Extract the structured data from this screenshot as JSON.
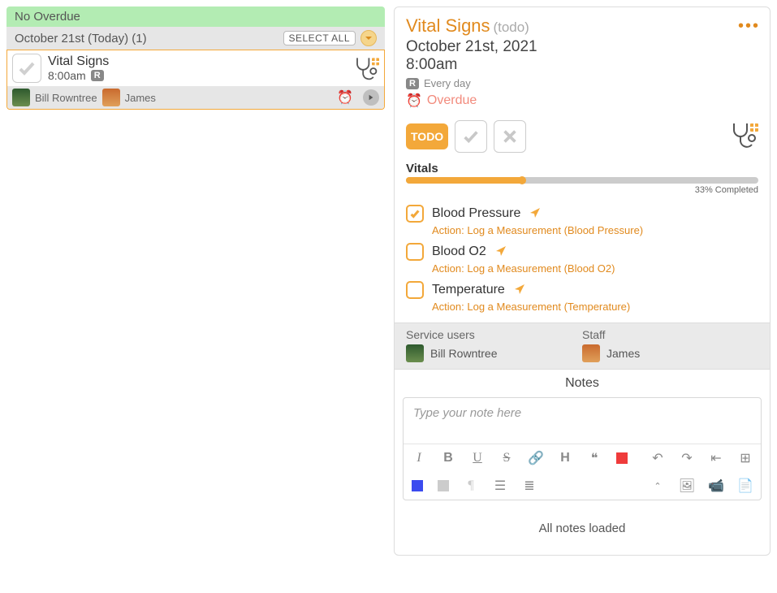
{
  "left": {
    "overdue": "No Overdue",
    "date_label": "October 21st (Today) (1)",
    "select_all": "SELECT ALL",
    "task": {
      "title": "Vital Signs",
      "time": "8:00am",
      "recur_badge": "R",
      "user1": "Bill Rowntree",
      "user2": "James"
    }
  },
  "detail": {
    "title": "Vital Signs",
    "status": "(todo)",
    "date": "October 21st, 2021",
    "time": "8:00am",
    "recur_badge": "R",
    "recur_text": "Every day",
    "overdue": "Overdue",
    "todo_btn": "TODO",
    "vitals_label": "Vitals",
    "progress_pct": 33,
    "progress_label": "33% Completed",
    "items": [
      {
        "name": "Blood Pressure",
        "action": "Action: Log a Measurement (Blood Pressure)",
        "checked": true
      },
      {
        "name": "Blood O2",
        "action": "Action: Log a Measurement (Blood O2)",
        "checked": false
      },
      {
        "name": "Temperature",
        "action": "Action: Log a Measurement (Temperature)",
        "checked": false
      }
    ],
    "people": {
      "su_head": "Service users",
      "su_name": "Bill Rowntree",
      "staff_head": "Staff",
      "staff_name": "James"
    },
    "notes_head": "Notes",
    "notes_placeholder": "Type your note here",
    "notes_loaded": "All notes loaded"
  }
}
